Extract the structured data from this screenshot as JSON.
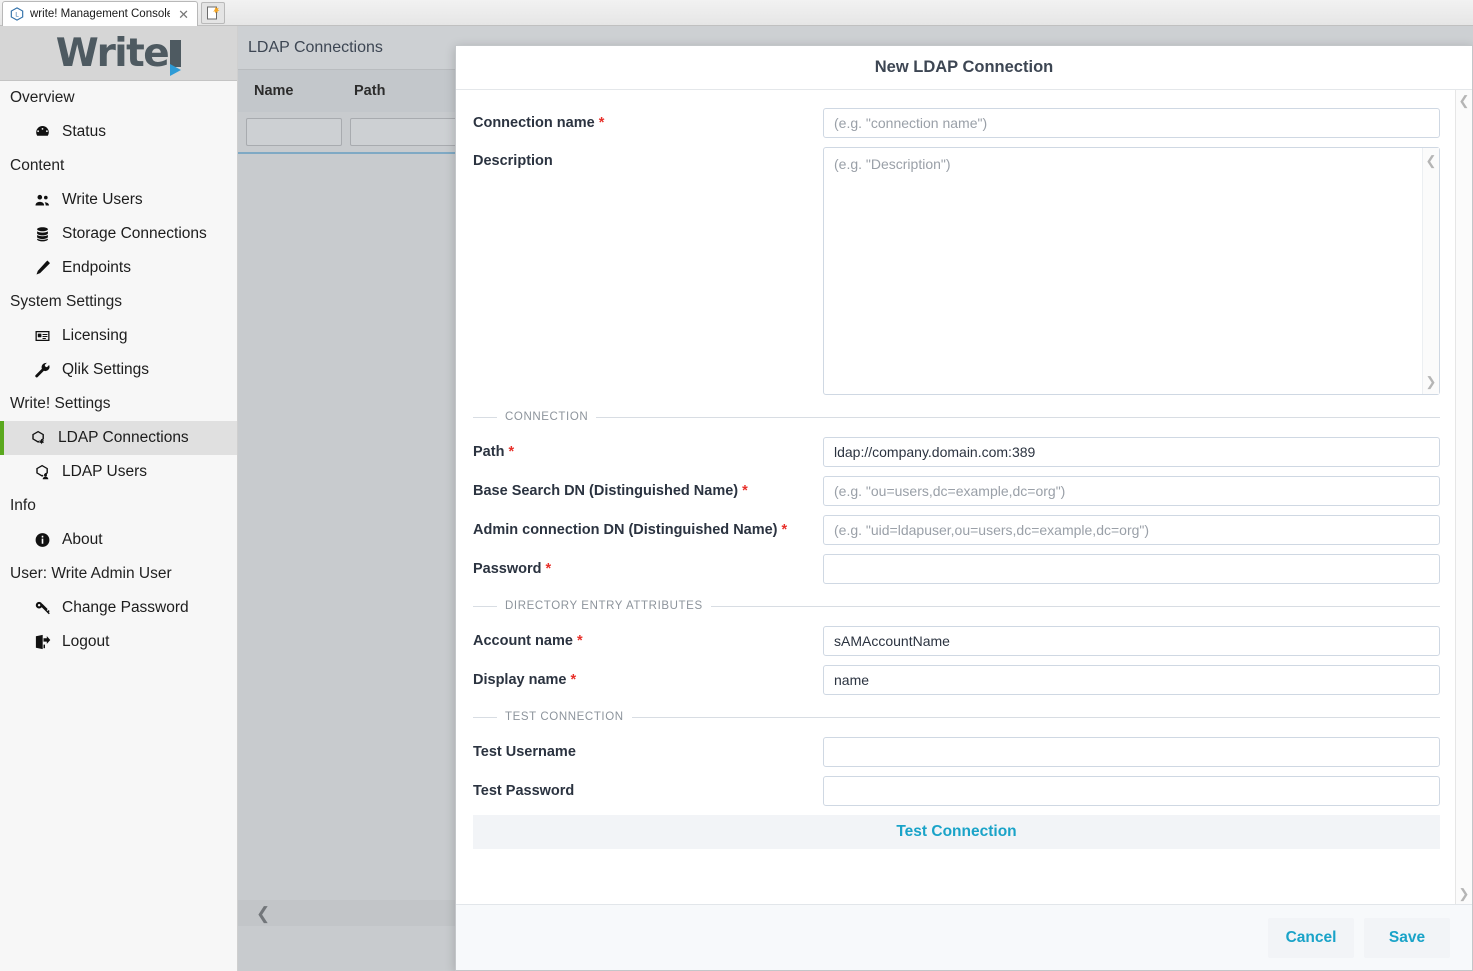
{
  "browser": {
    "tab_title": "write! Management Console",
    "close_icon": "close-icon",
    "new_tab_icon": "new-tab-icon"
  },
  "sidebar": {
    "brand": {
      "text": "Write",
      "accent_color": "#2e9bd6",
      "text_color": "#4e5a61"
    },
    "groups": [
      {
        "label": "Overview",
        "items": [
          {
            "label": "Status",
            "icon": "speedometer-icon",
            "active": false
          }
        ]
      },
      {
        "label": "Content",
        "items": [
          {
            "label": "Write Users",
            "icon": "users-icon",
            "active": false
          },
          {
            "label": "Storage Connections",
            "icon": "database-icon",
            "active": false
          },
          {
            "label": "Endpoints",
            "icon": "pencil-icon",
            "active": false
          }
        ]
      },
      {
        "label": "System Settings",
        "items": [
          {
            "label": "Licensing",
            "icon": "id-card-icon",
            "active": false
          },
          {
            "label": "Qlik Settings",
            "icon": "wrench-icon",
            "active": false
          }
        ]
      },
      {
        "label": "Write! Settings",
        "items": [
          {
            "label": "LDAP Connections",
            "icon": "ldap-connection-icon",
            "active": true
          },
          {
            "label": "LDAP Users",
            "icon": "ldap-user-icon",
            "active": false
          }
        ]
      },
      {
        "label": "Info",
        "items": [
          {
            "label": "About",
            "icon": "info-icon",
            "active": false
          }
        ]
      },
      {
        "label": "User: Write Admin User",
        "items": [
          {
            "label": "Change Password",
            "icon": "key-icon",
            "active": false
          },
          {
            "label": "Logout",
            "icon": "logout-icon",
            "active": false
          }
        ]
      }
    ],
    "active_accent_color": "#5aa81e"
  },
  "page": {
    "title": "LDAP Connections",
    "table": {
      "columns": [
        "Name",
        "Path"
      ],
      "filter_values": [
        "",
        ""
      ],
      "rows": []
    },
    "collapse_icon": "chevron-left-icon"
  },
  "modal": {
    "title": "New LDAP Connection",
    "fields": [
      {
        "label": "Connection name",
        "required": true,
        "placeholder": "(e.g. \"connection name\")",
        "value": ""
      },
      {
        "label": "Description",
        "required": false,
        "placeholder": "(e.g. \"Description\")",
        "value": ""
      }
    ],
    "sections": [
      {
        "legend": "CONNECTION",
        "fields": [
          {
            "label": "Path",
            "required": true,
            "placeholder": "",
            "value": "ldap://company.domain.com:389"
          },
          {
            "label": "Base Search DN (Distinguished Name)",
            "required": true,
            "placeholder": "(e.g. \"ou=users,dc=example,dc=org\")",
            "value": ""
          },
          {
            "label": "Admin connection DN (Distinguished Name)",
            "required": true,
            "placeholder": "(e.g. \"uid=ldapuser,ou=users,dc=example,dc=org\")",
            "value": ""
          },
          {
            "label": "Password",
            "required": true,
            "placeholder": "",
            "value": ""
          }
        ]
      },
      {
        "legend": "DIRECTORY ENTRY ATTRIBUTES",
        "fields": [
          {
            "label": "Account name",
            "required": true,
            "placeholder": "",
            "value": "sAMAccountName"
          },
          {
            "label": "Display name",
            "required": true,
            "placeholder": "",
            "value": "name"
          }
        ]
      },
      {
        "legend": "TEST CONNECTION",
        "fields": [
          {
            "label": "Test Username",
            "required": false,
            "placeholder": "",
            "value": ""
          },
          {
            "label": "Test Password",
            "required": false,
            "placeholder": "",
            "value": ""
          }
        ]
      }
    ],
    "test_connection_label": "Test Connection",
    "cancel_label": "Cancel",
    "save_label": "Save",
    "accent_color": "#1aa3c8",
    "required_marker": "*",
    "scroll_up_icon": "chevron-up-icon",
    "scroll_down_icon": "chevron-down-icon"
  }
}
